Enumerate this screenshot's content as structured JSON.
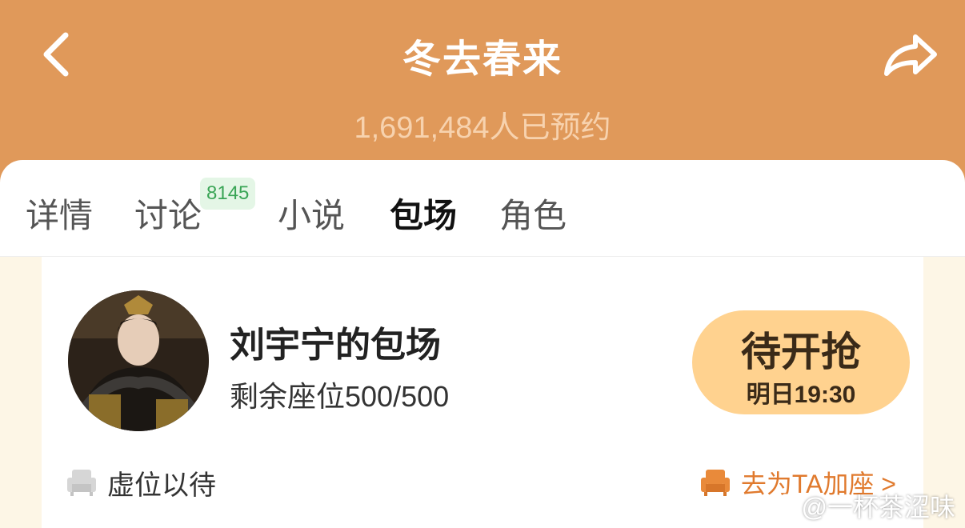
{
  "header": {
    "title": "冬去春来",
    "reservations": "1,691,484人已预约",
    "back_icon": "chevron-left-icon",
    "share_icon": "share-arrow-icon",
    "background": "#e0995a"
  },
  "tabs": [
    {
      "label": "详情",
      "active": false
    },
    {
      "label": "讨论",
      "active": false,
      "badge": "8145"
    },
    {
      "label": "小说",
      "active": false
    },
    {
      "label": "包场",
      "active": true
    },
    {
      "label": "角色",
      "active": false
    }
  ],
  "session": {
    "host_name": "刘宇宁的包场",
    "seats_remaining": "剩余座位500/500",
    "button_label": "待开抢",
    "button_time": "明日19:30",
    "button_color": "#ffd28f",
    "waiting_label": "虚位以待",
    "add_seat_link": "去为TA加座 >",
    "link_color": "#e07a2e"
  },
  "watermark": "@一杯茶涩味"
}
